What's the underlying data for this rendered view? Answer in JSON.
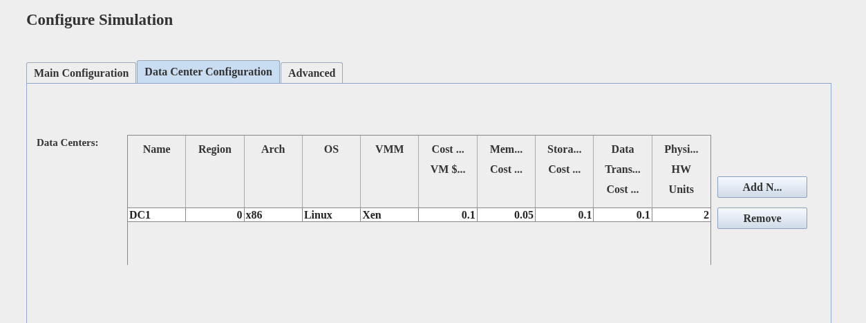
{
  "title": "Configure Simulation",
  "tabs": [
    {
      "label": "Main Configuration",
      "selected": false
    },
    {
      "label": "Data Center Configuration",
      "selected": true
    },
    {
      "label": "Advanced",
      "selected": false
    }
  ],
  "data_centers": {
    "label": "Data Centers:",
    "table": {
      "columns": [
        {
          "lines": [
            "Name"
          ],
          "kind": "text"
        },
        {
          "lines": [
            "Region"
          ],
          "kind": "number"
        },
        {
          "lines": [
            "Arch"
          ],
          "kind": "text"
        },
        {
          "lines": [
            "OS"
          ],
          "kind": "text"
        },
        {
          "lines": [
            "VMM"
          ],
          "kind": "text"
        },
        {
          "lines": [
            "Cost ...",
            "VM $..."
          ],
          "kind": "number"
        },
        {
          "lines": [
            "Mem...",
            "Cost ..."
          ],
          "kind": "number"
        },
        {
          "lines": [
            "Stora...",
            "Cost ..."
          ],
          "kind": "number"
        },
        {
          "lines": [
            "Data",
            "Trans...",
            "Cost ..."
          ],
          "kind": "number"
        },
        {
          "lines": [
            "Physi...",
            "HW",
            "Units"
          ],
          "kind": "number"
        }
      ],
      "rows": [
        [
          "DC1",
          "0",
          "x86",
          "Linux",
          "Xen",
          "0.1",
          "0.05",
          "0.1",
          "0.1",
          "2"
        ]
      ]
    },
    "buttons": [
      "Add N...",
      "Remove"
    ]
  }
}
